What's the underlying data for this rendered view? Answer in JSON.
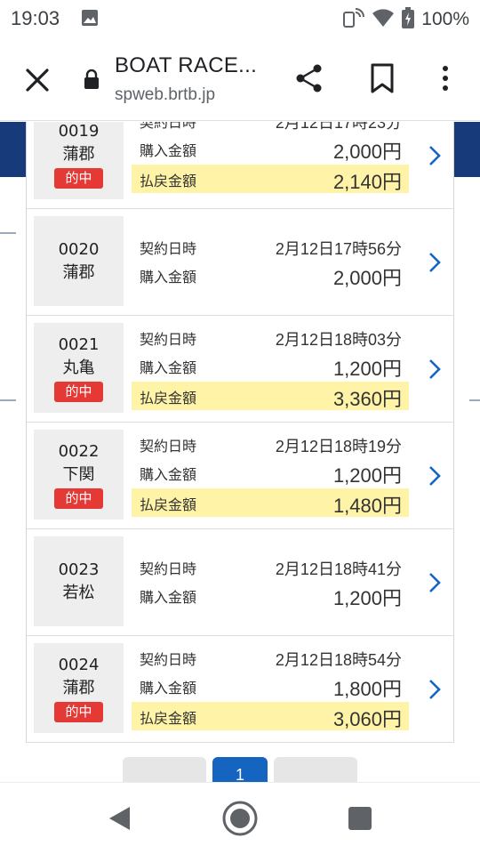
{
  "status_bar": {
    "time": "19:03",
    "battery": "100%",
    "icons": [
      "image-icon",
      "nfc-icon",
      "wifi-icon",
      "battery-charging-icon"
    ]
  },
  "toolbar": {
    "title": "BOAT RACE...",
    "url": "spweb.brtb.jp",
    "icons": [
      "close-icon",
      "lock-icon",
      "share-icon",
      "bookmark-icon",
      "more-vert-icon"
    ]
  },
  "labels": {
    "contract_time": "契約日時",
    "purchase_amount": "購入金額",
    "payout_amount": "払戻金額",
    "hit_badge": "的中"
  },
  "records": [
    {
      "number": "0019",
      "venue": "蒲郡",
      "hit": true,
      "contract_time": "2月12日17時23分",
      "purchase": "2,000円",
      "payout": "2,140円"
    },
    {
      "number": "0020",
      "venue": "蒲郡",
      "hit": false,
      "contract_time": "2月12日17時56分",
      "purchase": "2,000円",
      "payout": ""
    },
    {
      "number": "0021",
      "venue": "丸亀",
      "hit": true,
      "contract_time": "2月12日18時03分",
      "purchase": "1,200円",
      "payout": "3,360円"
    },
    {
      "number": "0022",
      "venue": "下関",
      "hit": true,
      "contract_time": "2月12日18時19分",
      "purchase": "1,200円",
      "payout": "1,480円"
    },
    {
      "number": "0023",
      "venue": "若松",
      "hit": false,
      "contract_time": "2月12日18時41分",
      "purchase": "1,200円",
      "payout": ""
    },
    {
      "number": "0024",
      "venue": "蒲郡",
      "hit": true,
      "contract_time": "2月12日18時54分",
      "purchase": "1,800円",
      "payout": "3,060円"
    }
  ],
  "pagination": {
    "current_page": "1"
  },
  "colors": {
    "hit_badge": "#e53935",
    "payout_bg": "#fff3a8",
    "chevron": "#1565c0",
    "current_page": "#1565c0"
  }
}
